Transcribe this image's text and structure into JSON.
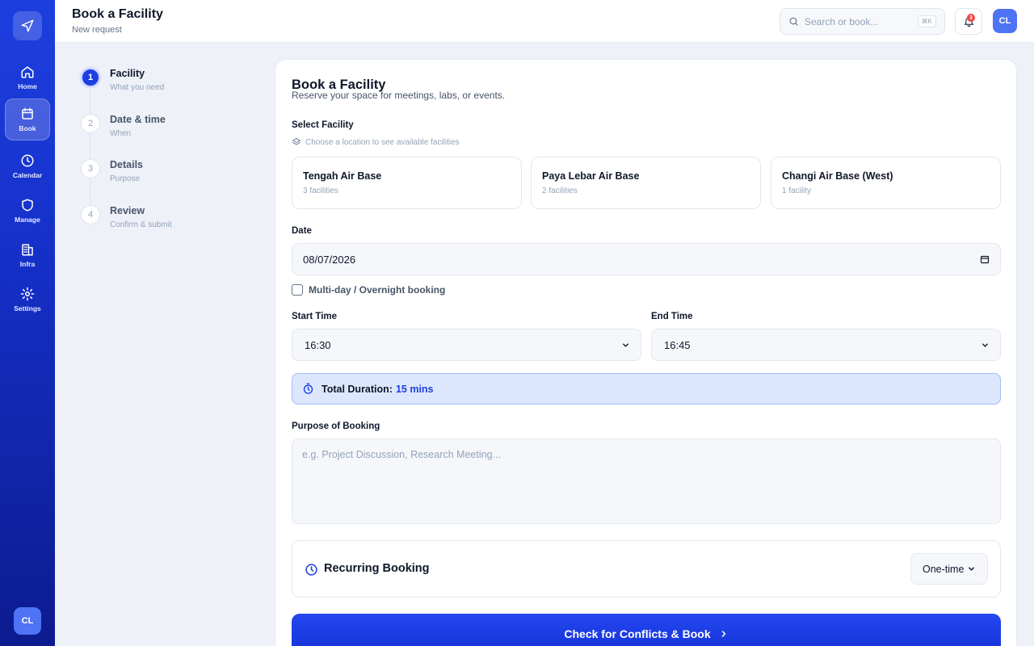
{
  "sidebar": {
    "items": [
      {
        "label": "Home"
      },
      {
        "label": "Book"
      },
      {
        "label": "Calendar"
      },
      {
        "label": "Manage"
      },
      {
        "label": "Infra"
      },
      {
        "label": "Settings"
      }
    ],
    "avatar": "CL"
  },
  "header": {
    "title": "Book a Facility",
    "subtitle": "New request",
    "search_placeholder": "Search or book...",
    "search_shortcut": "⌘K",
    "notification_count": "3",
    "avatar": "CL"
  },
  "steps": [
    {
      "number": "1",
      "title": "Facility",
      "subtitle": "What you need"
    },
    {
      "number": "2",
      "title": "Date & time",
      "subtitle": "When"
    },
    {
      "number": "3",
      "title": "Details",
      "subtitle": "Purpose"
    },
    {
      "number": "4",
      "title": "Review",
      "subtitle": "Confirm & submit"
    }
  ],
  "form": {
    "title": "Book a Facility",
    "subtitle": "Reserve your space for meetings, labs, or events.",
    "facility_label": "Select Facility",
    "facility_hint": "Choose a location to see available facilities",
    "facilities": [
      {
        "name": "Tengah Air Base",
        "count": "3 facilities"
      },
      {
        "name": "Paya Lebar Air Base",
        "count": "2 facilities"
      },
      {
        "name": "Changi Air Base (West)",
        "count": "1 facility"
      }
    ],
    "date_label": "Date",
    "date_value": "08/07/2026",
    "multiday_label": "Multi-day / Overnight booking",
    "start_label": "Start Time",
    "start_value": "16:30",
    "end_label": "End Time",
    "end_value": "16:45",
    "duration_label": "Total Duration:",
    "duration_value": "15 mins",
    "purpose_label": "Purpose of Booking",
    "purpose_placeholder": "e.g. Project Discussion, Research Meeting...",
    "recurring_label": "Recurring Booking",
    "recurring_value": "One-time",
    "submit_label": "Check for Conflicts & Book"
  },
  "colors": {
    "accent": "#1d3fe0",
    "duration_bg": "#dce7fd",
    "badge": "#ef4444"
  }
}
